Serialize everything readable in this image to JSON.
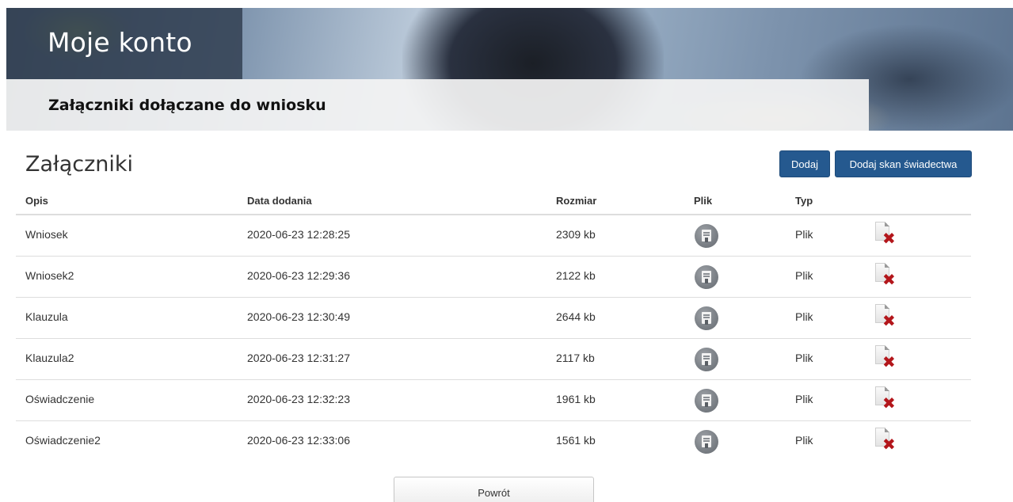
{
  "header": {
    "title": "Moje konto",
    "subtitle": "Załączniki dołączane do wniosku"
  },
  "section": {
    "title": "Załączniki",
    "add_label": "Dodaj",
    "add_scan_label": "Dodaj skan świadectwa"
  },
  "table": {
    "columns": {
      "opis": "Opis",
      "data": "Data dodania",
      "rozmiar": "Rozmiar",
      "plik": "Plik",
      "typ": "Typ"
    },
    "rows": [
      {
        "opis": "Wniosek",
        "data": "2020-06-23 12:28:25",
        "rozmiar": "2309 kb",
        "typ": "Plik"
      },
      {
        "opis": "Wniosek2",
        "data": "2020-06-23 12:29:36",
        "rozmiar": "2122 kb",
        "typ": "Plik"
      },
      {
        "opis": "Klauzula",
        "data": "2020-06-23 12:30:49",
        "rozmiar": "2644 kb",
        "typ": "Plik"
      },
      {
        "opis": "Klauzula2",
        "data": "2020-06-23 12:31:27",
        "rozmiar": "2117 kb",
        "typ": "Plik"
      },
      {
        "opis": "Oświadczenie",
        "data": "2020-06-23 12:32:23",
        "rozmiar": "1961 kb",
        "typ": "Plik"
      },
      {
        "opis": "Oświadczenie2",
        "data": "2020-06-23 12:33:06",
        "rozmiar": "1561 kb",
        "typ": "Plik"
      }
    ]
  },
  "footer": {
    "back_label": "Powrót"
  },
  "icons": {
    "file": "download-file-icon",
    "delete": "delete-file-icon"
  },
  "colors": {
    "primary_button": "#25598f",
    "delete_x": "#b3161b",
    "title_box": "#344254"
  }
}
